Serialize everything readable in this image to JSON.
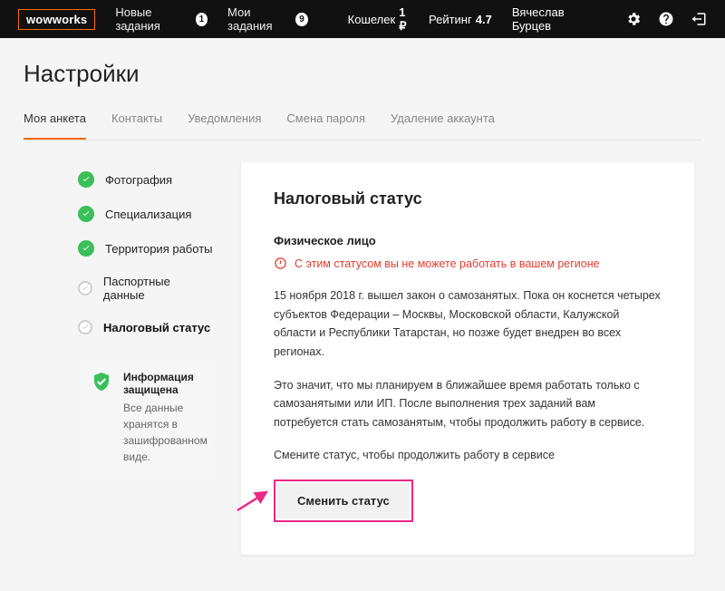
{
  "topbar": {
    "logo": "wowworks",
    "nav": {
      "new_tasks_label": "Новые задания",
      "new_tasks_count": "1",
      "my_tasks_label": "Мои задания",
      "my_tasks_count": "9"
    },
    "wallet_label": "Кошелек",
    "wallet_value": "1 ₽",
    "rating_label": "Рейтинг",
    "rating_value": "4.7",
    "username": "Вячеслав Бурцев"
  },
  "page_title": "Настройки",
  "tabs": [
    {
      "label": "Моя анкета",
      "active": true
    },
    {
      "label": "Контакты",
      "active": false
    },
    {
      "label": "Уведомления",
      "active": false
    },
    {
      "label": "Смена пароля",
      "active": false
    },
    {
      "label": "Удаление аккаунта",
      "active": false
    }
  ],
  "steps": [
    {
      "label": "Фотография",
      "state": "done"
    },
    {
      "label": "Специализация",
      "state": "done"
    },
    {
      "label": "Территория работы",
      "state": "done"
    },
    {
      "label": "Паспортные данные",
      "state": "pending"
    },
    {
      "label": "Налоговый статус",
      "state": "active-pending"
    }
  ],
  "protect": {
    "title": "Информация защищена",
    "body": "Все данные хранятся в зашифрованном виде."
  },
  "panel": {
    "heading": "Налоговый статус",
    "subhead": "Физическое лицо",
    "warning": "С этим статусом вы не можете работать в вашем регионе",
    "p1": "15 ноября 2018 г. вышел закон о самозанятых. Пока он коснется четырех субъектов Федерации – Москвы, Московской области, Калужской области и Республики Татарстан, но позже будет внедрен во всех регионах.",
    "p2": "Это значит, что мы планируем в ближайшее время работать только с самозанятыми или ИП. После выполнения трех заданий вам потребуется стать самозанятым, чтобы продолжить работу в сервисе.",
    "p3": "Смените статус, чтобы продолжить работу в сервисе",
    "button": "Сменить статус"
  }
}
